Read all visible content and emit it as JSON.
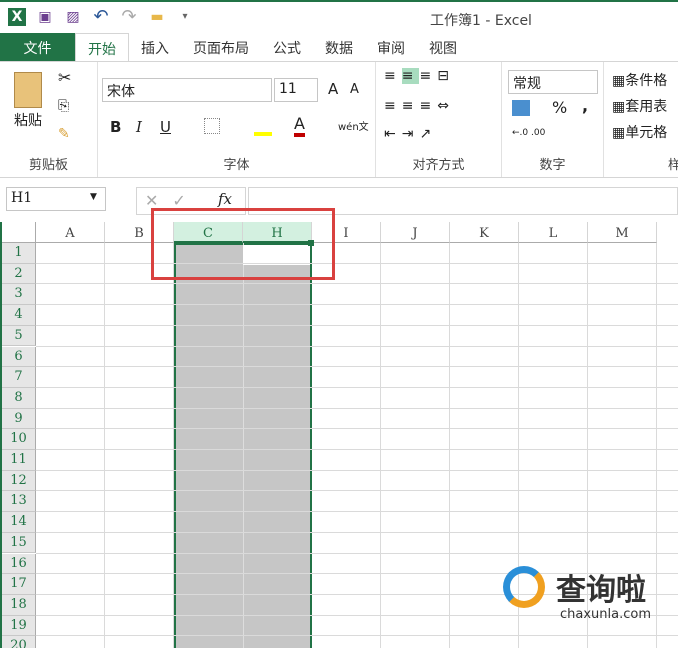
{
  "window": {
    "title": "工作簿1 - Excel"
  },
  "qat": [
    {
      "icon": "excel-logo-icon",
      "glyph": "X"
    },
    {
      "icon": "save-icon",
      "glyph": "▣"
    },
    {
      "icon": "save-as-icon",
      "glyph": "▨"
    },
    {
      "icon": "undo-icon",
      "glyph": "↶"
    },
    {
      "icon": "redo-icon",
      "glyph": "↷"
    },
    {
      "icon": "open-folder-icon",
      "glyph": "▬"
    },
    {
      "icon": "customize-icon",
      "glyph": "▾"
    }
  ],
  "tabs": [
    "文件",
    "开始",
    "插入",
    "页面布局",
    "公式",
    "数据",
    "审阅",
    "视图"
  ],
  "ribbon": {
    "clipboard": {
      "label": "剪贴板",
      "paste": "粘贴"
    },
    "font": {
      "label": "字体",
      "name": "宋体",
      "size": "11",
      "bold": "B",
      "italic": "I",
      "underline": "U",
      "color_letter": "A",
      "phonetic": "wén文",
      "grow": "A",
      "shrink": "A"
    },
    "align": {
      "label": "对齐方式"
    },
    "number": {
      "label": "数字",
      "format": "常规",
      "percent": "%",
      "comma": ","
    },
    "styles": {
      "label": "样式",
      "cond": "条件格",
      "table": "套用表",
      "cell": "单元格"
    }
  },
  "formula_bar": {
    "name_box": "H1",
    "fx": "fx",
    "value": ""
  },
  "columns": [
    "A",
    "B",
    "C",
    "H",
    "I",
    "J",
    "K",
    "L",
    "M"
  ],
  "rows": [
    "1",
    "2",
    "3",
    "4",
    "5",
    "6",
    "7",
    "8",
    "9",
    "10",
    "11",
    "12",
    "13",
    "14",
    "15",
    "16",
    "17",
    "18",
    "19",
    "20"
  ],
  "watermark": {
    "brand": "查询啦",
    "url": "chaxunla.com"
  },
  "colors": {
    "accent": "#217346",
    "selection": "#c6c6c6",
    "annotation": "#d9413f"
  }
}
